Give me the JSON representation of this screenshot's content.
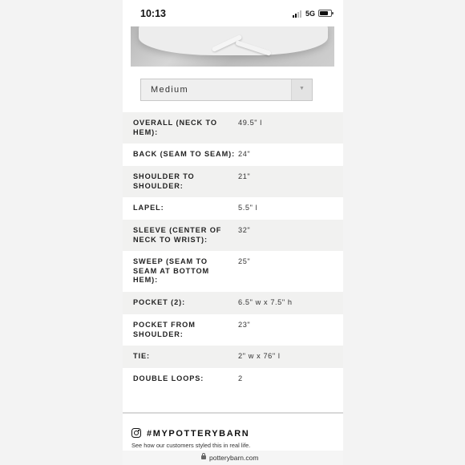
{
  "status_bar": {
    "time": "10:13",
    "network": "5G",
    "icons": [
      "signal-icon",
      "battery-icon"
    ]
  },
  "size_select": {
    "selected": "Medium",
    "icon": "chevron-down-icon"
  },
  "specs": [
    {
      "label": "OVERALL (NECK TO HEM):",
      "value": "49.5\" l"
    },
    {
      "label": "BACK (SEAM TO SEAM):",
      "value": "24\""
    },
    {
      "label": "SHOULDER TO SHOULDER:",
      "value": "21\""
    },
    {
      "label": "LAPEL:",
      "value": "5.5\" l"
    },
    {
      "label": "SLEEVE (CENTER OF NECK TO WRIST):",
      "value": "32\""
    },
    {
      "label": "SWEEP (SEAM TO SEAM AT BOTTOM HEM):",
      "value": "25\""
    },
    {
      "label": "POCKET (2):",
      "value": "6.5\" w x 7.5\" h"
    },
    {
      "label": "POCKET FROM SHOULDER:",
      "value": "23\""
    },
    {
      "label": "TIE:",
      "value": "2\" w x 76\" l"
    },
    {
      "label": "DOUBLE LOOPS:",
      "value": "2"
    }
  ],
  "instagram": {
    "hashtag": "#MYPOTTERYBARN",
    "subtext": "See how our customers styled this in real life.",
    "icon": "instagram-icon"
  },
  "browser": {
    "url": "potterybarn.com",
    "icon": "lock-icon"
  },
  "colors": {
    "row_alt": "#f1f1f0",
    "side_background": "#f3f3f3"
  }
}
